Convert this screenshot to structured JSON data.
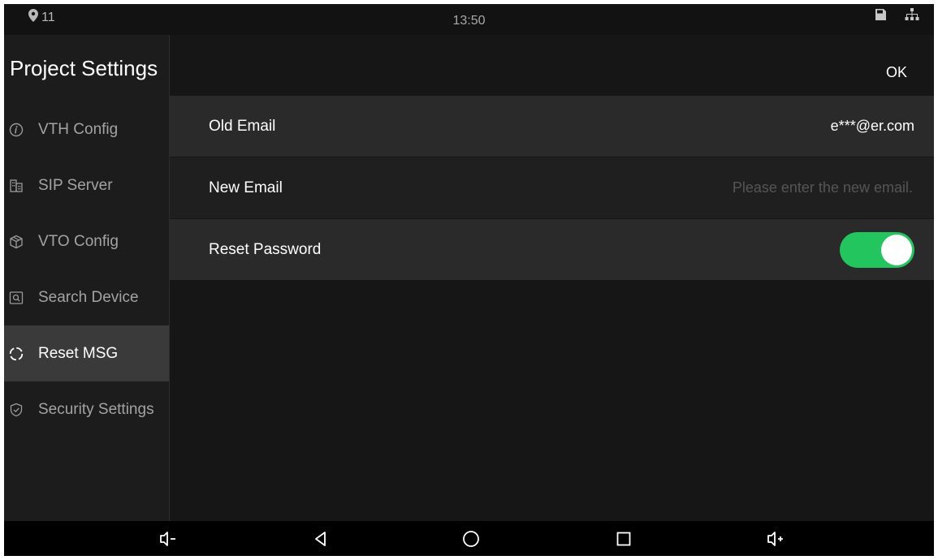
{
  "status_bar": {
    "location_count": "11",
    "time": "13:50",
    "icons": [
      "location-pin-icon",
      "sd-card-icon",
      "network-icon"
    ]
  },
  "sidebar": {
    "title": "Project Settings",
    "items": [
      {
        "label": "VTH Config",
        "icon": "info-icon",
        "active": false
      },
      {
        "label": "SIP Server",
        "icon": "building-icon",
        "active": false
      },
      {
        "label": "VTO Config",
        "icon": "cube-icon",
        "active": false
      },
      {
        "label": "Search Device",
        "icon": "search-device-icon",
        "active": false
      },
      {
        "label": "Reset MSG",
        "icon": "reset-icon",
        "active": true
      },
      {
        "label": "Security Settings",
        "icon": "shield-icon",
        "active": false
      }
    ]
  },
  "main": {
    "ok_label": "OK",
    "rows": {
      "old_email": {
        "label": "Old Email",
        "value": "e***@er.com"
      },
      "new_email": {
        "label": "New Email",
        "value": "",
        "placeholder": "Please enter the new email."
      },
      "reset_password": {
        "label": "Reset Password",
        "enabled": true
      }
    }
  },
  "nav_bar": {
    "buttons": [
      "volume-down-icon",
      "back-icon",
      "home-icon",
      "recents-icon",
      "volume-up-icon"
    ]
  },
  "colors": {
    "toggle_on": "#22c55e",
    "active_item_bg": "#3a3a3a",
    "background": "#161616"
  }
}
